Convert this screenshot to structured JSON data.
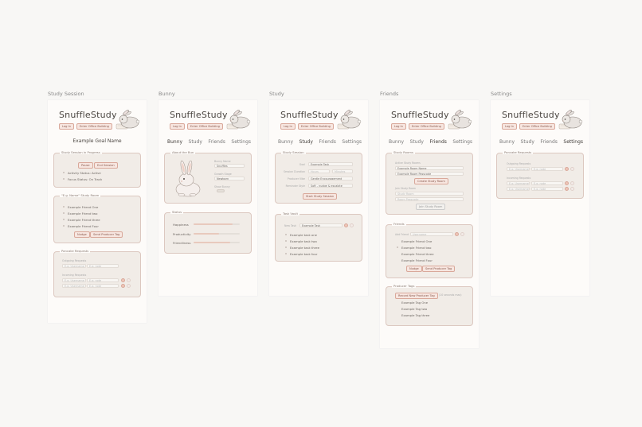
{
  "frames": {
    "session": {
      "title": "Study Session"
    },
    "bunny": {
      "title": "Bunny"
    },
    "study": {
      "title": "Study"
    },
    "friends": {
      "title": "Friends"
    },
    "settings": {
      "title": "Settings"
    }
  },
  "header": {
    "brand": "SnuffleStudy",
    "login": "Log In",
    "building": "Enter Office Building"
  },
  "nav": {
    "bunny": "Bunny",
    "study": "Study",
    "friends": "Friends",
    "settings": "Settings"
  },
  "session": {
    "goal_name": "Example Goal Name",
    "progress_title": "Study Session in Progress",
    "pause": "Pause",
    "end": "End Session",
    "activity_status": "Activity Status: Active",
    "focus_status": "Focus Status: On Track",
    "room_title": "\"E.g. Name\" Study Room",
    "friends": [
      "Example Friend One",
      "Example Friend two",
      "Example Friend three",
      "Example Friend Four"
    ],
    "nudge": "Nudge",
    "send_tag": "Send Producer Tag"
  },
  "requests": {
    "title": "Pancake Requests",
    "outgoing_label": "Outgoing Requests",
    "incoming_label": "Incoming Requests",
    "username_ph": "E.g. Username",
    "note_ph": "E.g. note"
  },
  "bunny": {
    "about_title": "About the Bun",
    "bunny_name_label": "Bunny Name",
    "bunny_name": "Snuffles",
    "growth_label": "Growth Stage",
    "growth": "Newborn",
    "show_bunny_label": "Show Bunny",
    "status_title": "Status",
    "stats": [
      {
        "label": "Happiness",
        "value": 0.85
      },
      {
        "label": "Productivity",
        "value": 0.55
      },
      {
        "label": "Friendliness",
        "value": 0.8
      }
    ]
  },
  "study": {
    "session_title": "Study Session",
    "goal_label": "Goal",
    "goal_value": "Example Task",
    "duration_label": "Session Duration",
    "duration_ph1": "Hours",
    "duration_ph2": "Minutes",
    "producer_label": "Producer Vibe",
    "producer_value": "Gentle Encouragement",
    "reminder_label": "Reminder Style",
    "reminder_value": "Soft - nudge & escalate",
    "start": "Start Study Session",
    "vault_title": "Task Vault",
    "new_task_label": "New Task",
    "new_task_value": "Example Task",
    "tasks": [
      "Example task one",
      "Example task two",
      "Example task three",
      "Example task four"
    ]
  },
  "friends": {
    "rooms_title": "Study Rooms",
    "active_label": "Active Study Rooms",
    "room_name": "Example Room Name",
    "room_passcode": "Example Room Passcode",
    "create": "Create Study Room",
    "join_label": "Join Study Room",
    "join_name_ph": "Study Room",
    "join_pass_ph": "Room Passcode",
    "join": "Join Study Room",
    "friends_title": "Friends",
    "add_friend_label": "Add Friend",
    "add_friend_ph": "Username",
    "friends": [
      "Example Friend One",
      "Example Friend two",
      "Example Friend three",
      "Example Friend Four"
    ],
    "nudge": "Nudge",
    "send_tag": "Send Producer Tag",
    "tags_title": "Producer Tags",
    "record": "Record New Producer Tag",
    "recording_note": "(10 seconds max)",
    "tags": [
      "Example Tag One",
      "Example Tag two",
      "Example Tag three"
    ]
  },
  "colors": {
    "accent": "#efc6b8",
    "accent_border": "#d9a89a",
    "card": "#f1ece7",
    "page": "#f8f7f5"
  }
}
